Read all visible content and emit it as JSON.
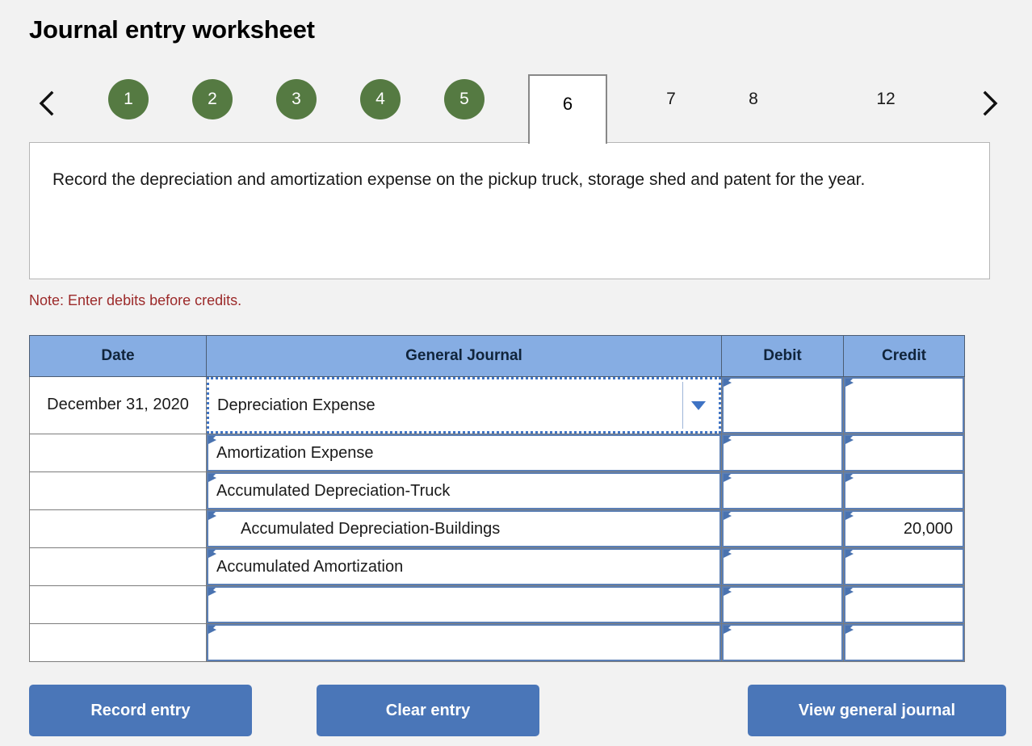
{
  "page": {
    "title": "Journal entry worksheet",
    "note": "Note: Enter debits before credits.",
    "instruction": "Record the depreciation and amortization expense on the pickup truck, storage shed and patent for the year."
  },
  "nav": {
    "prev_icon": "chevron-left-icon",
    "next_icon": "chevron-right-icon",
    "completed_steps": [
      "1",
      "2",
      "3",
      "4",
      "5"
    ],
    "active_tab": "6",
    "upcoming_tabs": [
      "7",
      "8",
      "12"
    ]
  },
  "table": {
    "headers": {
      "date": "Date",
      "general_journal": "General Journal",
      "debit": "Debit",
      "credit": "Credit"
    },
    "rows": [
      {
        "date": "December 31, 2020",
        "account": "Depreciation Expense",
        "debit": "",
        "credit": "",
        "selected": true,
        "indent": 0
      },
      {
        "date": "",
        "account": "Amortization Expense",
        "debit": "",
        "credit": "",
        "selected": false,
        "indent": 0
      },
      {
        "date": "",
        "account": "Accumulated Depreciation-Truck",
        "debit": "",
        "credit": "",
        "selected": false,
        "indent": 0
      },
      {
        "date": "",
        "account": "Accumulated Depreciation-Buildings",
        "debit": "",
        "credit": "20,000",
        "selected": false,
        "indent": 1
      },
      {
        "date": "",
        "account": "Accumulated Amortization",
        "debit": "",
        "credit": "",
        "selected": false,
        "indent": 0
      },
      {
        "date": "",
        "account": "",
        "debit": "",
        "credit": "",
        "selected": false,
        "indent": 0
      },
      {
        "date": "",
        "account": "",
        "debit": "",
        "credit": "",
        "selected": false,
        "indent": 0
      }
    ]
  },
  "buttons": {
    "record": "Record entry",
    "clear": "Clear entry",
    "view": "View general journal"
  },
  "colors": {
    "page_background": "#f2f2f2",
    "step_green": "#557a42",
    "header_blue": "#86ade3",
    "button_blue": "#4a76b8",
    "note_red": "#9c2a2a",
    "cell_border_blue": "#5b7fb5",
    "selection_blue": "#3e73c4"
  }
}
